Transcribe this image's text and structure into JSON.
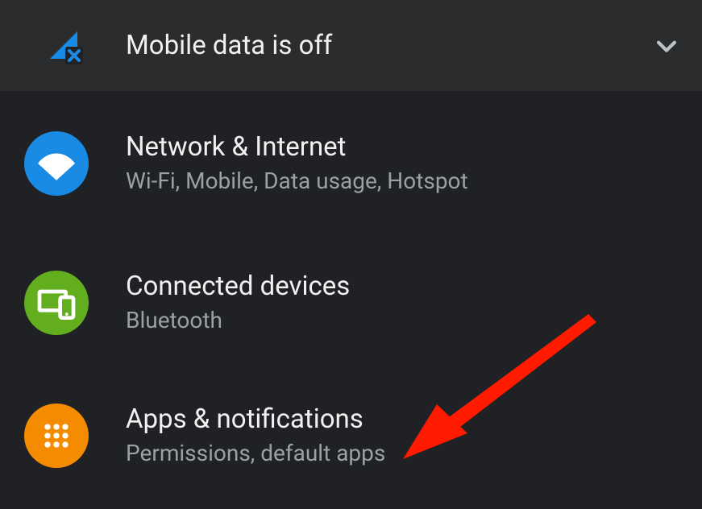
{
  "banner": {
    "title": "Mobile data is off"
  },
  "items": [
    {
      "title": "Network & Internet",
      "subtitle": "Wi-Fi, Mobile, Data usage, Hotspot"
    },
    {
      "title": "Connected devices",
      "subtitle": "Bluetooth"
    },
    {
      "title": "Apps & notifications",
      "subtitle": "Permissions, default apps"
    }
  ]
}
